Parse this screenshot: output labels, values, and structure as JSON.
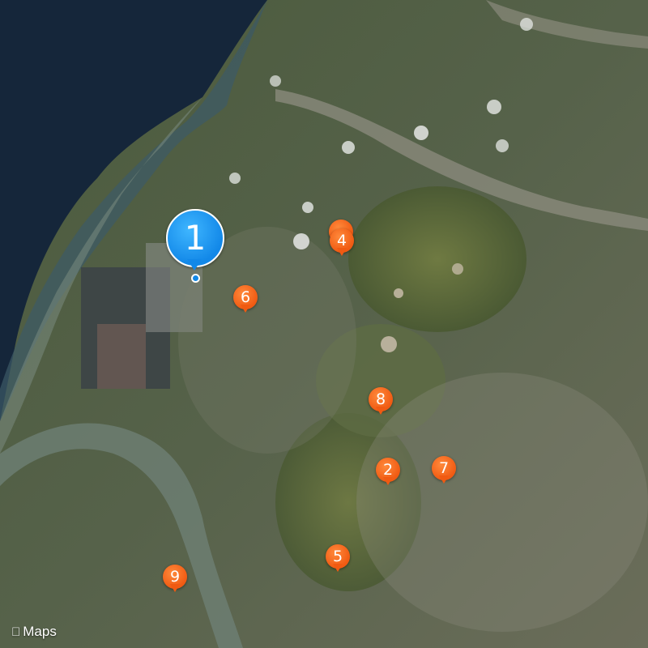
{
  "map": {
    "view": "satellite",
    "attribution": {
      "logo_icon": "apple-logo-icon",
      "label": "Maps"
    },
    "selected_pin": {
      "label": "1",
      "color": "#1a8fec"
    },
    "pins": [
      {
        "label": "2",
        "color": "#f25a14"
      },
      {
        "label": "4",
        "color": "#f25a14"
      },
      {
        "label": "5",
        "color": "#f25a14"
      },
      {
        "label": "6",
        "color": "#f25a14"
      },
      {
        "label": "7",
        "color": "#f25a14"
      },
      {
        "label": "8",
        "color": "#f25a14"
      },
      {
        "label": "9",
        "color": "#f25a14"
      }
    ]
  }
}
